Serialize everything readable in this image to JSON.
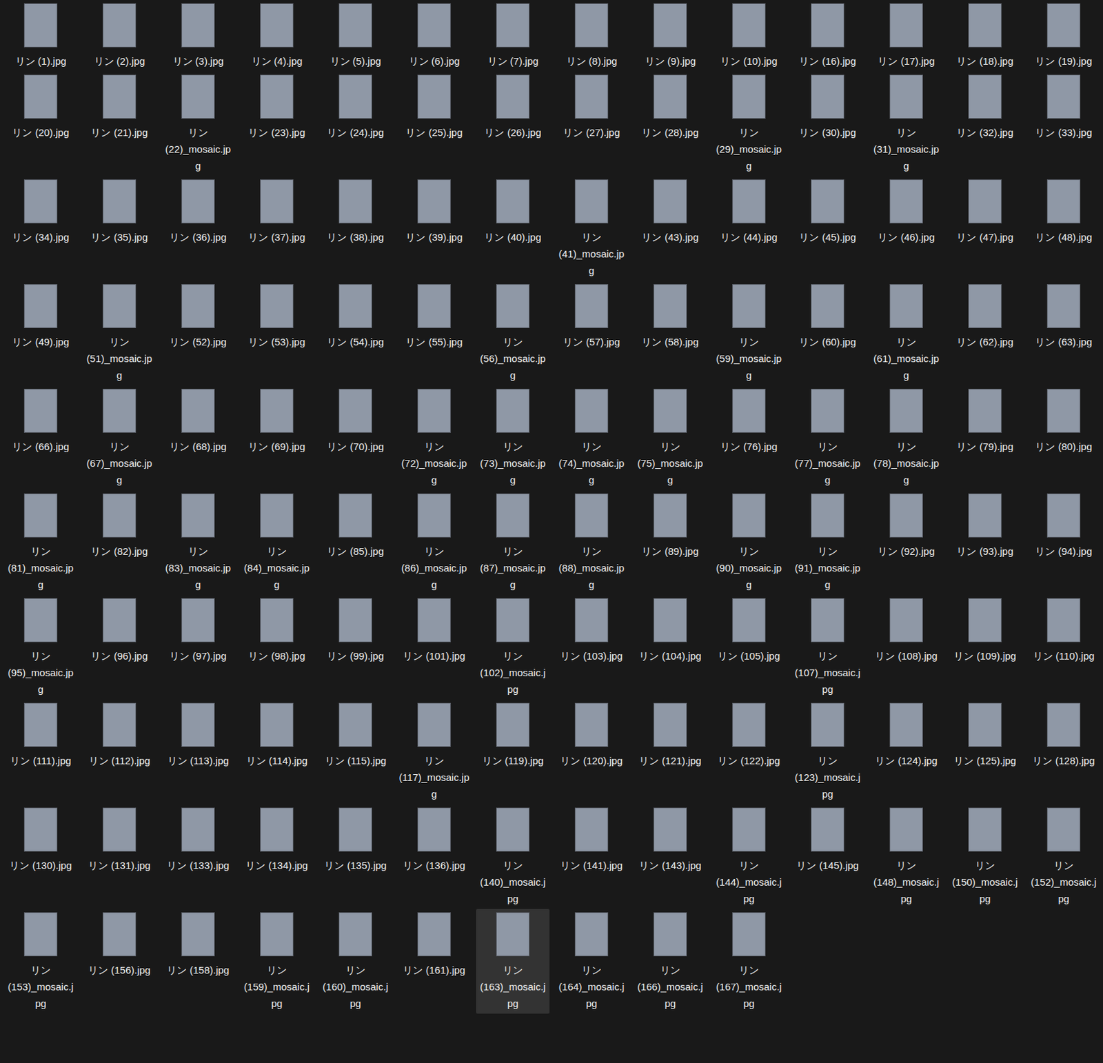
{
  "files": [
    {
      "name": "リン (1).jpg",
      "selected": false
    },
    {
      "name": "リン (2).jpg",
      "selected": false
    },
    {
      "name": "リン (3).jpg",
      "selected": false
    },
    {
      "name": "リン (4).jpg",
      "selected": false
    },
    {
      "name": "リン (5).jpg",
      "selected": false
    },
    {
      "name": "リン (6).jpg",
      "selected": false
    },
    {
      "name": "リン (7).jpg",
      "selected": false
    },
    {
      "name": "リン (8).jpg",
      "selected": false
    },
    {
      "name": "リン (9).jpg",
      "selected": false
    },
    {
      "name": "リン (10).jpg",
      "selected": false
    },
    {
      "name": "リン (16).jpg",
      "selected": false
    },
    {
      "name": "リン (17).jpg",
      "selected": false
    },
    {
      "name": "リン (18).jpg",
      "selected": false
    },
    {
      "name": "リン (19).jpg",
      "selected": false
    },
    {
      "name": "リン (20).jpg",
      "selected": false
    },
    {
      "name": "リン (21).jpg",
      "selected": false
    },
    {
      "name": "リン (22)_mosaic.jpg",
      "selected": false
    },
    {
      "name": "リン (23).jpg",
      "selected": false
    },
    {
      "name": "リン (24).jpg",
      "selected": false
    },
    {
      "name": "リン (25).jpg",
      "selected": false
    },
    {
      "name": "リン (26).jpg",
      "selected": false
    },
    {
      "name": "リン (27).jpg",
      "selected": false
    },
    {
      "name": "リン (28).jpg",
      "selected": false
    },
    {
      "name": "リン (29)_mosaic.jpg",
      "selected": false
    },
    {
      "name": "リン (30).jpg",
      "selected": false
    },
    {
      "name": "リン (31)_mosaic.jpg",
      "selected": false
    },
    {
      "name": "リン (32).jpg",
      "selected": false
    },
    {
      "name": "リン (33).jpg",
      "selected": false
    },
    {
      "name": "リン (34).jpg",
      "selected": false
    },
    {
      "name": "リン (35).jpg",
      "selected": false
    },
    {
      "name": "リン (36).jpg",
      "selected": false
    },
    {
      "name": "リン (37).jpg",
      "selected": false
    },
    {
      "name": "リン (38).jpg",
      "selected": false
    },
    {
      "name": "リン (39).jpg",
      "selected": false
    },
    {
      "name": "リン (40).jpg",
      "selected": false
    },
    {
      "name": "リン (41)_mosaic.jpg",
      "selected": false
    },
    {
      "name": "リン (43).jpg",
      "selected": false
    },
    {
      "name": "リン (44).jpg",
      "selected": false
    },
    {
      "name": "リン (45).jpg",
      "selected": false
    },
    {
      "name": "リン (46).jpg",
      "selected": false
    },
    {
      "name": "リン (47).jpg",
      "selected": false
    },
    {
      "name": "リン (48).jpg",
      "selected": false
    },
    {
      "name": "リン (49).jpg",
      "selected": false
    },
    {
      "name": "リン (51)_mosaic.jpg",
      "selected": false
    },
    {
      "name": "リン (52).jpg",
      "selected": false
    },
    {
      "name": "リン (53).jpg",
      "selected": false
    },
    {
      "name": "リン (54).jpg",
      "selected": false
    },
    {
      "name": "リン (55).jpg",
      "selected": false
    },
    {
      "name": "リン (56)_mosaic.jpg",
      "selected": false
    },
    {
      "name": "リン (57).jpg",
      "selected": false
    },
    {
      "name": "リン (58).jpg",
      "selected": false
    },
    {
      "name": "リン (59)_mosaic.jpg",
      "selected": false
    },
    {
      "name": "リン (60).jpg",
      "selected": false
    },
    {
      "name": "リン (61)_mosaic.jpg",
      "selected": false
    },
    {
      "name": "リン (62).jpg",
      "selected": false
    },
    {
      "name": "リン (63).jpg",
      "selected": false
    },
    {
      "name": "リン (66).jpg",
      "selected": false
    },
    {
      "name": "リン (67)_mosaic.jpg",
      "selected": false
    },
    {
      "name": "リン (68).jpg",
      "selected": false
    },
    {
      "name": "リン (69).jpg",
      "selected": false
    },
    {
      "name": "リン (70).jpg",
      "selected": false
    },
    {
      "name": "リン (72)_mosaic.jpg",
      "selected": false
    },
    {
      "name": "リン (73)_mosaic.jpg",
      "selected": false
    },
    {
      "name": "リン (74)_mosaic.jpg",
      "selected": false
    },
    {
      "name": "リン (75)_mosaic.jpg",
      "selected": false
    },
    {
      "name": "リン (76).jpg",
      "selected": false
    },
    {
      "name": "リン (77)_mosaic.jpg",
      "selected": false
    },
    {
      "name": "リン (78)_mosaic.jpg",
      "selected": false
    },
    {
      "name": "リン (79).jpg",
      "selected": false
    },
    {
      "name": "リン (80).jpg",
      "selected": false
    },
    {
      "name": "リン (81)_mosaic.jpg",
      "selected": false
    },
    {
      "name": "リン (82).jpg",
      "selected": false
    },
    {
      "name": "リン (83)_mosaic.jpg",
      "selected": false
    },
    {
      "name": "リン (84)_mosaic.jpg",
      "selected": false
    },
    {
      "name": "リン (85).jpg",
      "selected": false
    },
    {
      "name": "リン (86)_mosaic.jpg",
      "selected": false
    },
    {
      "name": "リン (87)_mosaic.jpg",
      "selected": false
    },
    {
      "name": "リン (88)_mosaic.jpg",
      "selected": false
    },
    {
      "name": "リン (89).jpg",
      "selected": false
    },
    {
      "name": "リン (90)_mosaic.jpg",
      "selected": false
    },
    {
      "name": "リン (91)_mosaic.jpg",
      "selected": false
    },
    {
      "name": "リン (92).jpg",
      "selected": false
    },
    {
      "name": "リン (93).jpg",
      "selected": false
    },
    {
      "name": "リン (94).jpg",
      "selected": false
    },
    {
      "name": "リン (95)_mosaic.jpg",
      "selected": false
    },
    {
      "name": "リン (96).jpg",
      "selected": false
    },
    {
      "name": "リン (97).jpg",
      "selected": false
    },
    {
      "name": "リン (98).jpg",
      "selected": false
    },
    {
      "name": "リン (99).jpg",
      "selected": false
    },
    {
      "name": "リン (101).jpg",
      "selected": false
    },
    {
      "name": "リン (102)_mosaic.jpg",
      "selected": false
    },
    {
      "name": "リン (103).jpg",
      "selected": false
    },
    {
      "name": "リン (104).jpg",
      "selected": false
    },
    {
      "name": "リン (105).jpg",
      "selected": false
    },
    {
      "name": "リン (107)_mosaic.jpg",
      "selected": false
    },
    {
      "name": "リン (108).jpg",
      "selected": false
    },
    {
      "name": "リン (109).jpg",
      "selected": false
    },
    {
      "name": "リン (110).jpg",
      "selected": false
    },
    {
      "name": "リン (111).jpg",
      "selected": false
    },
    {
      "name": "リン (112).jpg",
      "selected": false
    },
    {
      "name": "リン (113).jpg",
      "selected": false
    },
    {
      "name": "リン (114).jpg",
      "selected": false
    },
    {
      "name": "リン (115).jpg",
      "selected": false
    },
    {
      "name": "リン (117)_mosaic.jpg",
      "selected": false
    },
    {
      "name": "リン (119).jpg",
      "selected": false
    },
    {
      "name": "リン (120).jpg",
      "selected": false
    },
    {
      "name": "リン (121).jpg",
      "selected": false
    },
    {
      "name": "リン (122).jpg",
      "selected": false
    },
    {
      "name": "リン (123)_mosaic.jpg",
      "selected": false
    },
    {
      "name": "リン (124).jpg",
      "selected": false
    },
    {
      "name": "リン (125).jpg",
      "selected": false
    },
    {
      "name": "リン (128).jpg",
      "selected": false
    },
    {
      "name": "リン (130).jpg",
      "selected": false
    },
    {
      "name": "リン (131).jpg",
      "selected": false
    },
    {
      "name": "リン (133).jpg",
      "selected": false
    },
    {
      "name": "リン (134).jpg",
      "selected": false
    },
    {
      "name": "リン (135).jpg",
      "selected": false
    },
    {
      "name": "リン (136).jpg",
      "selected": false
    },
    {
      "name": "リン (140)_mosaic.jpg",
      "selected": false
    },
    {
      "name": "リン (141).jpg",
      "selected": false
    },
    {
      "name": "リン (143).jpg",
      "selected": false
    },
    {
      "name": "リン (144)_mosaic.jpg",
      "selected": false
    },
    {
      "name": "リン (145).jpg",
      "selected": false
    },
    {
      "name": "リン (148)_mosaic.jpg",
      "selected": false
    },
    {
      "name": "リン (150)_mosaic.jpg",
      "selected": false
    },
    {
      "name": "リン (152)_mosaic.jpg",
      "selected": false
    },
    {
      "name": "リン (153)_mosaic.jpg",
      "selected": false
    },
    {
      "name": "リン (156).jpg",
      "selected": false
    },
    {
      "name": "リン (158).jpg",
      "selected": false
    },
    {
      "name": "リン (159)_mosaic.jpg",
      "selected": false
    },
    {
      "name": "リン (160)_mosaic.jpg",
      "selected": false
    },
    {
      "name": "リン (161).jpg",
      "selected": false
    },
    {
      "name": "リン (163)_mosaic.jpg",
      "selected": true
    },
    {
      "name": "リン (164)_mosaic.jpg",
      "selected": false
    },
    {
      "name": "リン (166)_mosaic.jpg",
      "selected": false
    },
    {
      "name": "リン (167)_mosaic.jpg",
      "selected": false
    }
  ]
}
